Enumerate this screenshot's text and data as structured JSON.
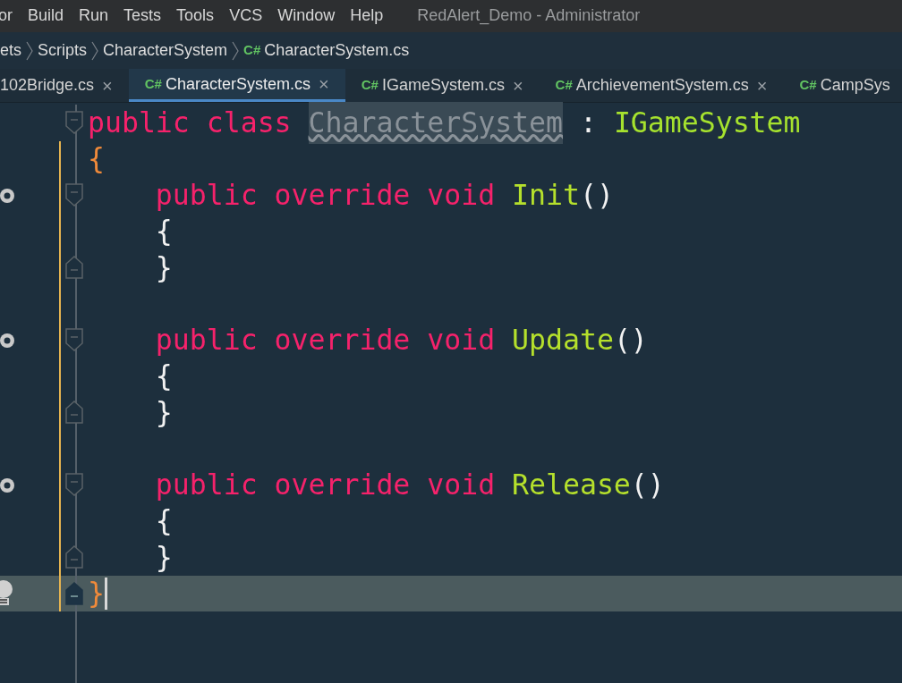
{
  "menu": [
    "or",
    "Build",
    "Run",
    "Tests",
    "Tools",
    "VCS",
    "Window",
    "Help"
  ],
  "window": {
    "title": "RedAlert_Demo - Administrator"
  },
  "breadcrumbs": [
    {
      "label": "ets",
      "kind": "folder"
    },
    {
      "label": "Scripts",
      "kind": "folder"
    },
    {
      "label": "CharacterSystem",
      "kind": "folder"
    },
    {
      "label": "CharacterSystem.cs",
      "kind": "file",
      "badge": "C#"
    }
  ],
  "tabs": [
    {
      "label": "102Bridge.cs",
      "close": "×",
      "selected": false
    },
    {
      "label": "CharacterSystem.cs",
      "badge": "C#",
      "close": "×",
      "selected": true
    },
    {
      "label": "IGameSystem.cs",
      "badge": "C#",
      "close": "×",
      "selected": false
    },
    {
      "label": "ArchievementSystem.cs",
      "badge": "C#",
      "close": "×",
      "selected": false
    },
    {
      "label": "CampSys",
      "badge": "C#",
      "selected": false
    }
  ],
  "code": [
    {
      "fold_start": true,
      "changed": false,
      "tokens": [
        {
          "text": "public",
          "kind": "keyword",
          "gap": true
        },
        {
          "text": "class",
          "kind": "keyword",
          "gap": true
        },
        {
          "text": "CharacterSystem",
          "kind": "unused",
          "gap": true
        },
        {
          "text": ":",
          "kind": "plain",
          "gap": true
        },
        {
          "text": "IGameSystem",
          "kind": "type"
        }
      ]
    },
    {
      "changed": true,
      "tokens": [
        {
          "text": "{",
          "kind": "brace"
        }
      ]
    },
    {
      "changed": true,
      "indented": true,
      "override_marker": true,
      "fold_start": true,
      "tokens": [
        {
          "text": "public",
          "kind": "keyword",
          "gap": true
        },
        {
          "text": "override",
          "kind": "keyword",
          "gap": true
        },
        {
          "text": "void",
          "kind": "keyword",
          "gap": true
        },
        {
          "text": "Init",
          "kind": "method"
        },
        {
          "text": "()",
          "kind": "plain"
        }
      ]
    },
    {
      "changed": true,
      "indented": true,
      "tokens": [
        {
          "text": "{",
          "kind": "plain"
        }
      ]
    },
    {
      "changed": true,
      "indented": true,
      "fold_end": true,
      "tokens": [
        {
          "text": "}",
          "kind": "plain"
        }
      ]
    },
    {
      "changed": true
    },
    {
      "changed": true,
      "indented": true,
      "override_marker": true,
      "fold_start": true,
      "tokens": [
        {
          "text": "public",
          "kind": "keyword",
          "gap": true
        },
        {
          "text": "override",
          "kind": "keyword",
          "gap": true
        },
        {
          "text": "void",
          "kind": "keyword",
          "gap": true
        },
        {
          "text": "Update",
          "kind": "method"
        },
        {
          "text": "()",
          "kind": "plain"
        }
      ]
    },
    {
      "changed": true,
      "indented": true,
      "tokens": [
        {
          "text": "{",
          "kind": "plain"
        }
      ]
    },
    {
      "changed": true,
      "indented": true,
      "fold_end": true,
      "tokens": [
        {
          "text": "}",
          "kind": "plain"
        }
      ]
    },
    {
      "changed": true
    },
    {
      "changed": true,
      "indented": true,
      "override_marker": true,
      "fold_start": true,
      "tokens": [
        {
          "text": "public",
          "kind": "keyword",
          "gap": true
        },
        {
          "text": "override",
          "kind": "keyword",
          "gap": true
        },
        {
          "text": "void",
          "kind": "keyword",
          "gap": true
        },
        {
          "text": "Release",
          "kind": "method"
        },
        {
          "text": "()",
          "kind": "plain"
        }
      ]
    },
    {
      "changed": true,
      "indented": true,
      "tokens": [
        {
          "text": "{",
          "kind": "plain"
        }
      ]
    },
    {
      "changed": true,
      "indented": true,
      "fold_end": true,
      "tokens": [
        {
          "text": "}",
          "kind": "plain"
        }
      ]
    },
    {
      "changed": true,
      "current": true,
      "bulb": true,
      "fold_end": true,
      "tokens": [
        {
          "text": "}",
          "kind": "brace"
        }
      ]
    }
  ]
}
